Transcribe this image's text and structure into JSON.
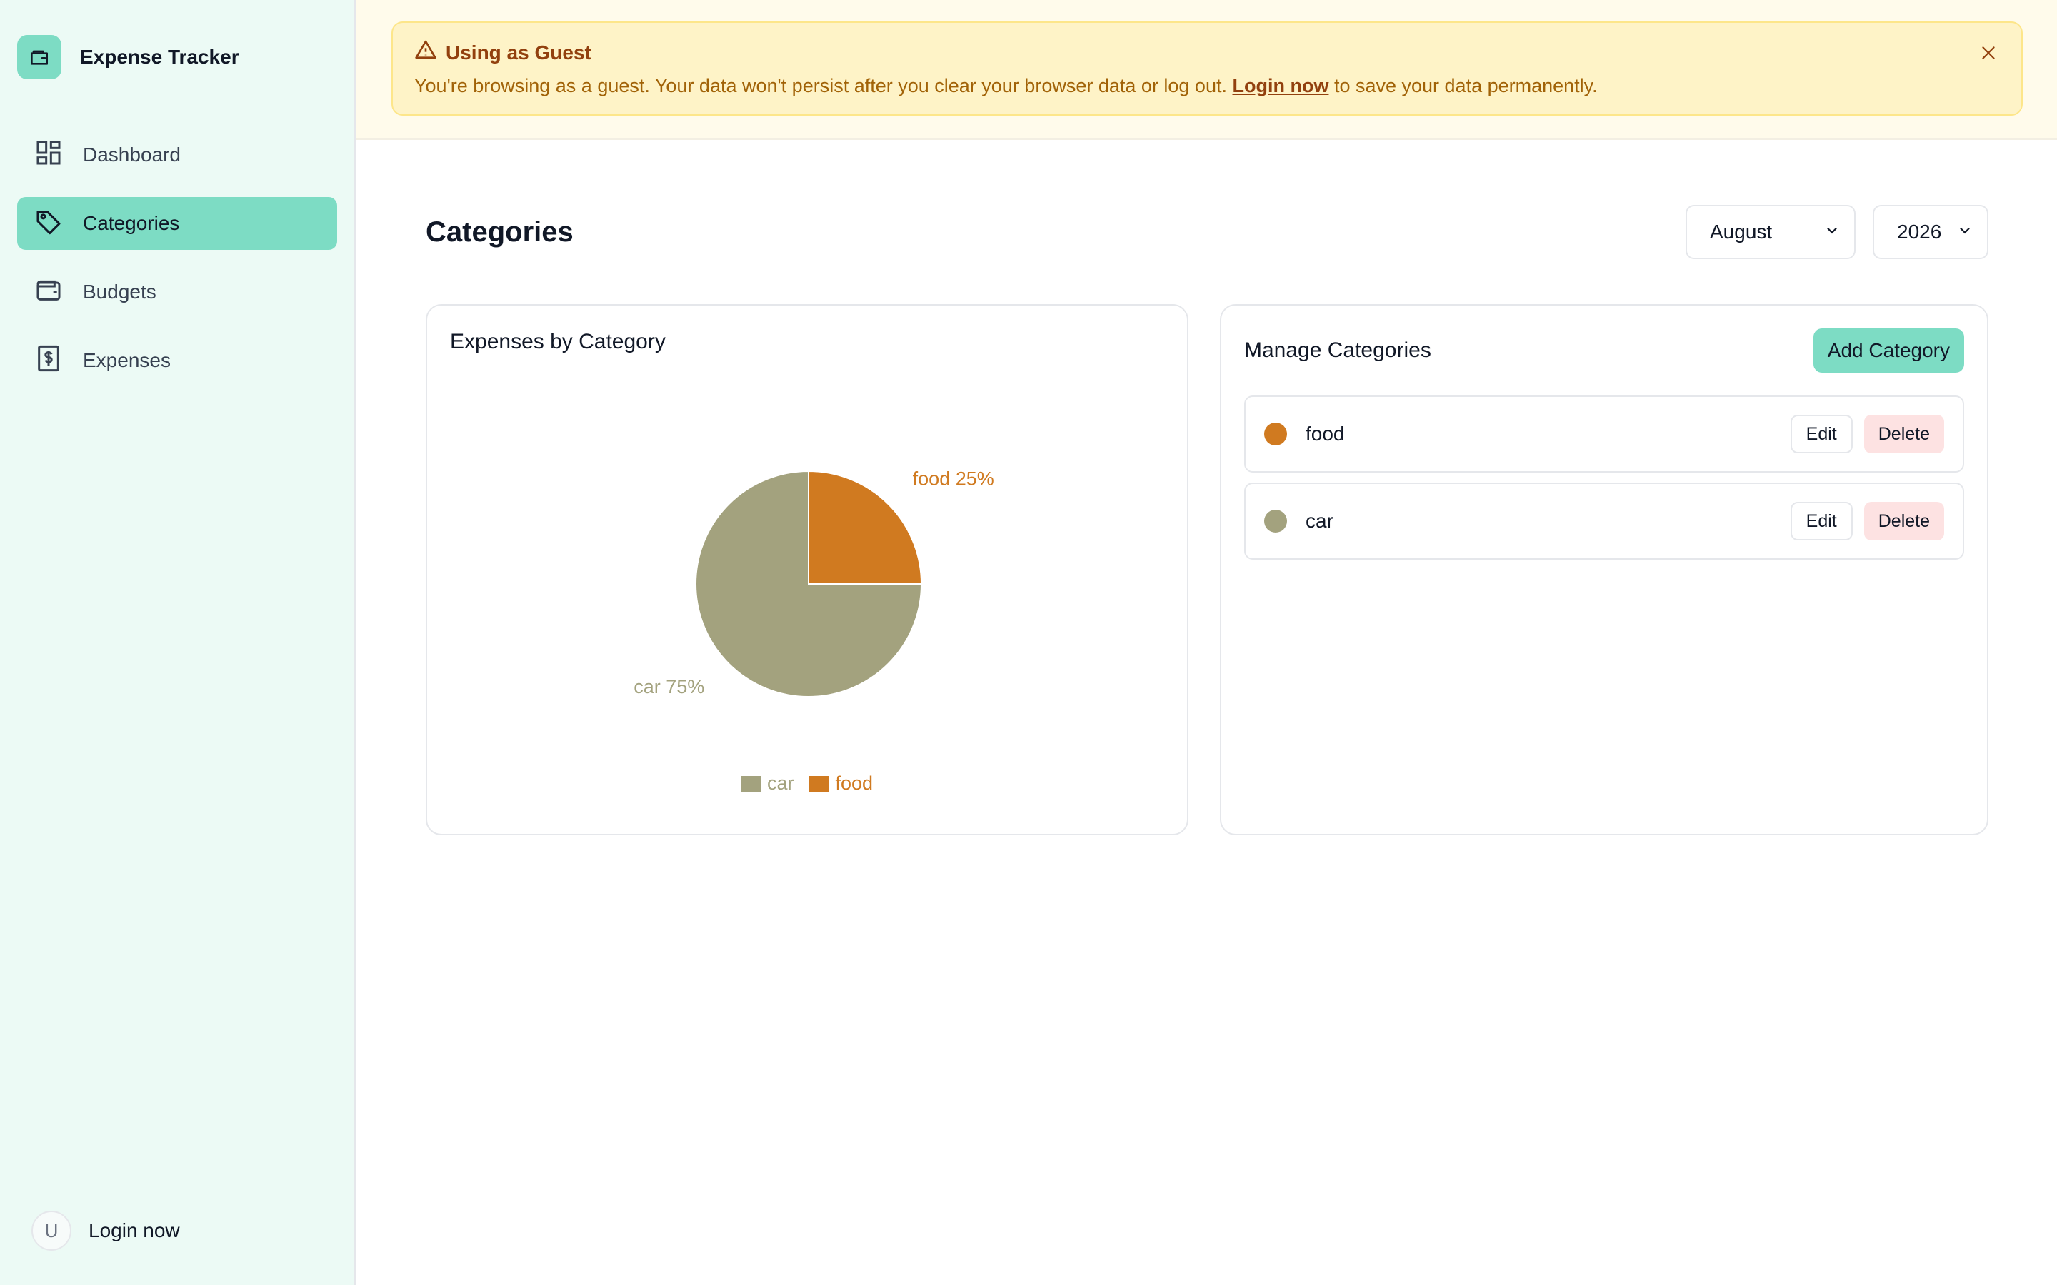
{
  "app": {
    "title": "Expense Tracker"
  },
  "sidebar": {
    "items": [
      {
        "label": "Dashboard",
        "icon": "dashboard-grid-icon",
        "active": false
      },
      {
        "label": "Categories",
        "icon": "tag-icon",
        "active": true
      },
      {
        "label": "Budgets",
        "icon": "wallet-icon",
        "active": false
      },
      {
        "label": "Expenses",
        "icon": "receipt-dollar-icon",
        "active": false
      }
    ],
    "user": {
      "avatar_initial": "U",
      "label": "Login now"
    }
  },
  "banner": {
    "title": "Using as Guest",
    "text_before": "You're browsing as a guest. Your data won't persist after you clear your browser data or log out. ",
    "link": "Login now",
    "text_after": " to save your data permanently."
  },
  "page": {
    "title": "Categories",
    "month": "August",
    "year": "2026"
  },
  "chart_card": {
    "title": "Expenses by Category"
  },
  "manage": {
    "title": "Manage Categories",
    "add_label": "Add Category",
    "edit_label": "Edit",
    "delete_label": "Delete",
    "categories": [
      {
        "name": "food",
        "color": "#d07a20"
      },
      {
        "name": "car",
        "color": "#a3a27e"
      }
    ]
  },
  "chart_data": {
    "type": "pie",
    "slices": [
      {
        "label": "food",
        "value": 25,
        "display": "food 25%",
        "color": "#d07a20"
      },
      {
        "label": "car",
        "value": 75,
        "display": "car 75%",
        "color": "#a3a27e"
      }
    ],
    "legend": [
      "car",
      "food"
    ],
    "legend_placement": "bottom"
  },
  "colors": {
    "accent": "#7ddcc4",
    "sidebar_bg": "#ecfaf5",
    "banner_bg": "#fef3c7",
    "banner_text": "#92400e"
  }
}
